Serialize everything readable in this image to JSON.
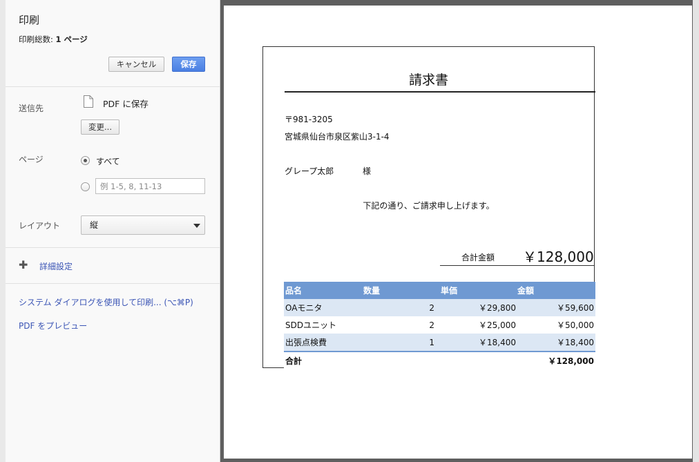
{
  "dialog": {
    "title": "印刷",
    "total_label": "印刷総数: ",
    "total_value": "1 ページ",
    "cancel_label": "キャンセル",
    "save_label": "保存"
  },
  "destination": {
    "label": "送信先",
    "name": "PDF に保存",
    "change_label": "変更..."
  },
  "pages": {
    "label": "ページ",
    "all_label": "すべて",
    "custom_placeholder": "例 1-5, 8, 11-13",
    "selected": "all"
  },
  "layout": {
    "label": "レイアウト",
    "value": "縦"
  },
  "advanced_label": "詳細設定",
  "links": {
    "system_dialog": "システム ダイアログを使用して印刷... (⌥⌘P)",
    "pdf_preview": "PDF をプレビュー"
  },
  "invoice": {
    "title": "請求書",
    "postal": "〒981-3205",
    "address": "宮城県仙台市泉区紫山3-1-4",
    "recipient": "グレープ太郎",
    "honorific": "様",
    "message": "下記の通り、ご請求申し上げます。",
    "total_label": "合計金額",
    "total_amount": "￥128,000",
    "headers": [
      "品名",
      "数量",
      "単価",
      "金額"
    ],
    "rows": [
      {
        "name": "OAモニタ",
        "qty": "2",
        "price": "￥29,800",
        "amount": "￥59,600"
      },
      {
        "name": "SDDユニット",
        "qty": "2",
        "price": "￥25,000",
        "amount": "￥50,000"
      },
      {
        "name": "出張点検費",
        "qty": "1",
        "price": "￥18,400",
        "amount": "￥18,400"
      }
    ],
    "sum_label": "合計",
    "sum_amount": "￥128,000"
  }
}
